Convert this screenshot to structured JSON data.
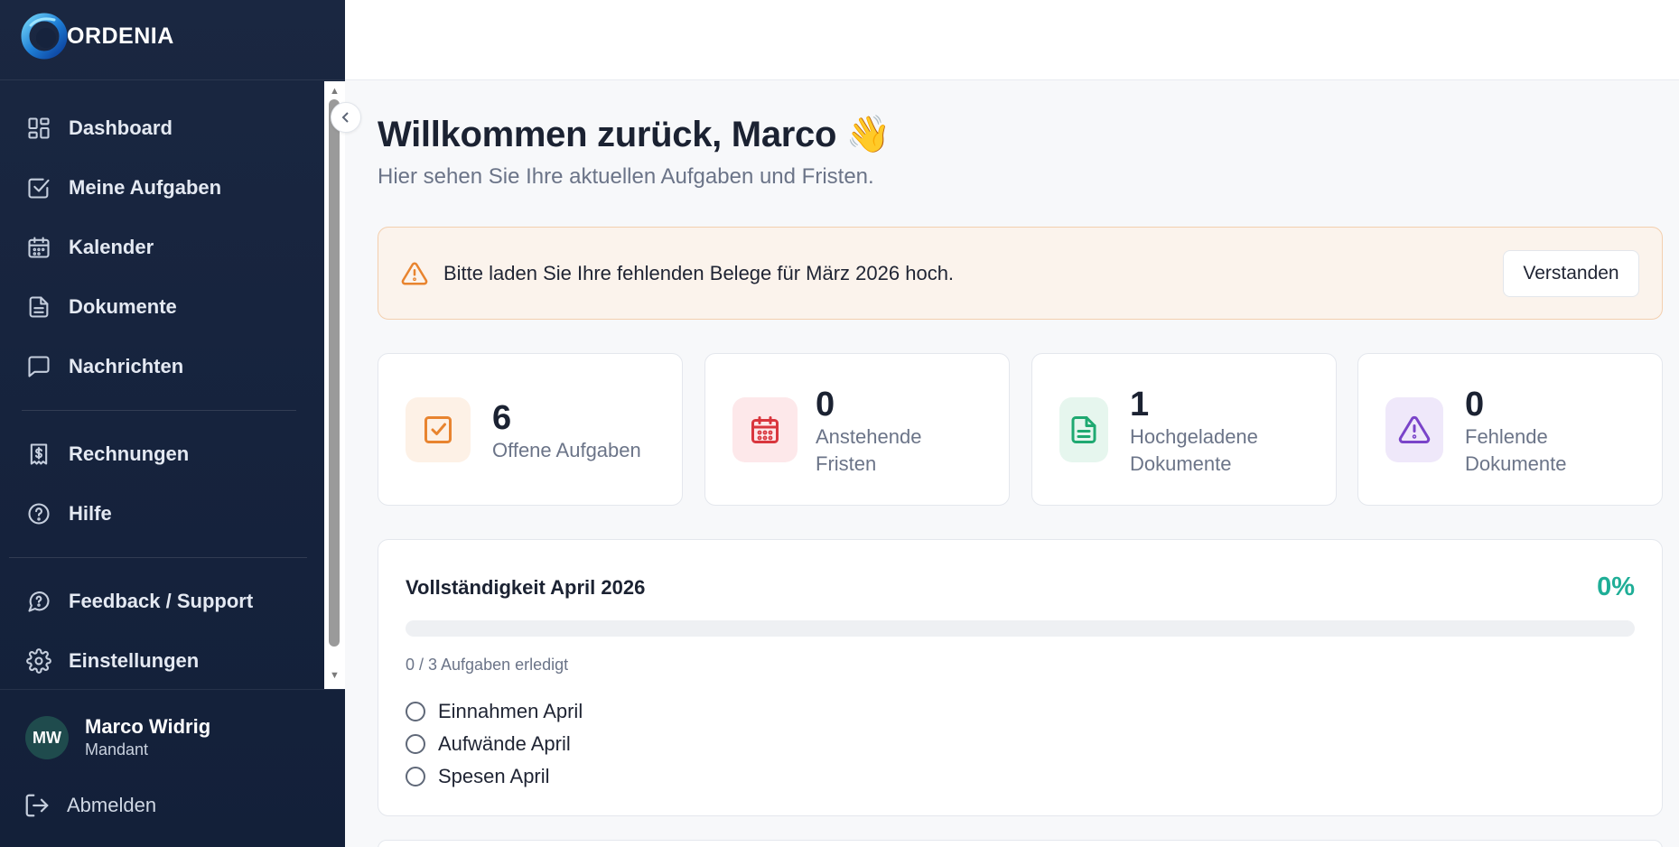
{
  "app": {
    "brand": "ORDENIA"
  },
  "sidebar": {
    "items": [
      {
        "label": "Dashboard",
        "icon": "dashboard-grid-icon"
      },
      {
        "label": "Meine Aufgaben",
        "icon": "checkbox-icon"
      },
      {
        "label": "Kalender",
        "icon": "calendar-icon"
      },
      {
        "label": "Dokumente",
        "icon": "document-icon"
      },
      {
        "label": "Nachrichten",
        "icon": "chat-bubble-icon"
      },
      {
        "label": "Rechnungen",
        "icon": "receipt-icon"
      },
      {
        "label": "Hilfe",
        "icon": "help-circle-icon"
      },
      {
        "label": "Feedback / Support",
        "icon": "support-icon"
      },
      {
        "label": "Einstellungen",
        "icon": "gear-icon"
      }
    ],
    "user": {
      "initials": "MW",
      "name": "Marco Widrig",
      "role": "Mandant"
    },
    "logout_label": "Abmelden"
  },
  "main": {
    "welcome": "Willkommen zurück, Marco 👋",
    "subtitle": "Hier sehen Sie Ihre aktuellen Aufgaben und Fristen.",
    "alert": {
      "text": "Bitte laden Sie Ihre fehlenden Belege für März 2026 hoch.",
      "button": "Verstanden",
      "color": "#e8842f"
    },
    "stats": [
      {
        "value": "6",
        "label": "Offene Aufgaben",
        "icon": "checkbox-icon",
        "color": "#e8842f",
        "bg": "#fdf1e6"
      },
      {
        "value": "0",
        "label": "Anstehende Fristen",
        "icon": "calendar-icon",
        "color": "#d9363e",
        "bg": "#fde8ea"
      },
      {
        "value": "1",
        "label": "Hochgeladene Dokumente",
        "icon": "document-icon",
        "color": "#1fa971",
        "bg": "#e6f6ee"
      },
      {
        "value": "0",
        "label": "Fehlende Dokumente",
        "icon": "warning-triangle-icon",
        "color": "#7a44c9",
        "bg": "#efe8fa"
      }
    ],
    "progress": {
      "title": "Vollständigkeit April 2026",
      "percent_label": "0%",
      "percent": 0,
      "count_label": "0 / 3 Aufgaben erledigt",
      "accent": "#1fae97",
      "items": [
        "Einnahmen April",
        "Aufwände April",
        "Spesen April"
      ]
    }
  }
}
